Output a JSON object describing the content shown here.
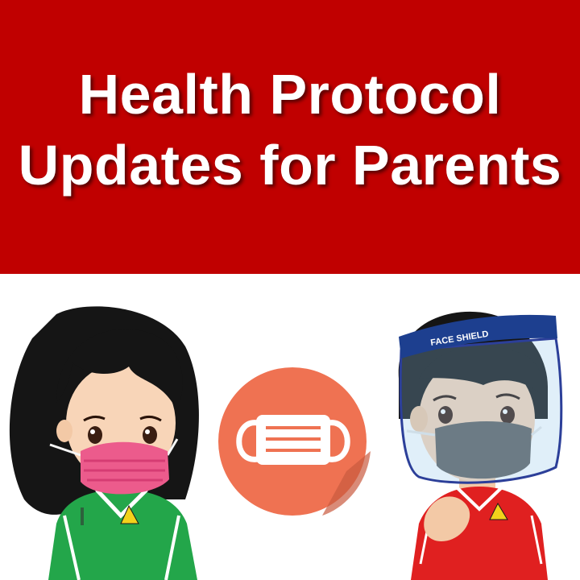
{
  "banner": {
    "title_line1": "Health Protocol",
    "title_line2": "Updates for Parents"
  },
  "illustration": {
    "face_shield_label": "FACE SHIELD",
    "icon": "face-mask-icon"
  },
  "colors": {
    "banner_red": "#c00000",
    "circle_orange": "#ef7252",
    "pink_mask": "#ec5b8c",
    "grey_mask": "#5f5f5f",
    "green_shirt": "#23a64a",
    "red_shirt": "#e02020",
    "shield_blue": "#1d3f8f"
  }
}
